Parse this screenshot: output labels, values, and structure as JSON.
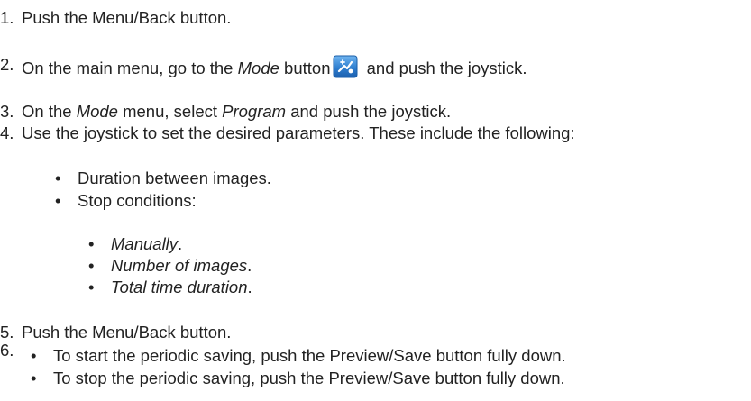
{
  "steps": [
    {
      "num": "1.",
      "text": "Push the Menu/Back button."
    },
    {
      "num": "2.",
      "pre": "On the main menu, go to the ",
      "em": "Mode",
      "mid": " button",
      "icon": "mode-icon",
      "post": " and push the joystick."
    },
    {
      "num": "3.",
      "pre": "On the ",
      "em": "Mode",
      "mid": " menu, select ",
      "em2": "Program",
      "post": " and push the joystick."
    },
    {
      "num": "4.",
      "text": "Use the joystick to set the desired parameters. These include the following:"
    },
    {
      "num": "5.",
      "text": "Push the Menu/Back button."
    },
    {
      "num": "6."
    }
  ],
  "params": {
    "bullet": "•",
    "items": [
      "Duration between images.",
      "Stop conditions:"
    ],
    "stop_conditions": [
      "Manually",
      "Number of images",
      "Total time duration"
    ],
    "period": "."
  },
  "step6_items": [
    "To start the periodic saving, push the Preview/Save button fully down.",
    "To stop the periodic saving, push the Preview/Save button fully down."
  ],
  "colors": {
    "text": "#222222",
    "icon_bg": "#2f7fd0",
    "icon_border": "#1a5ea8"
  }
}
